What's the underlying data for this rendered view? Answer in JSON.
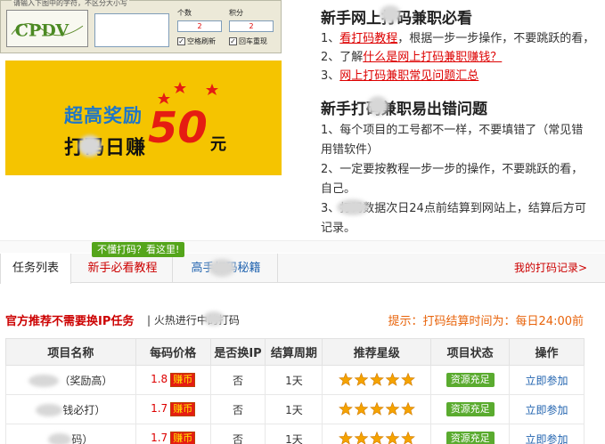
{
  "captcha": {
    "legend": "请输入下图中的字符，不区分大小写",
    "count_label": "个数",
    "count_value": "2",
    "score_label": "积分",
    "score_value": "2",
    "refresh_label": "空格刷新",
    "enter_label": "回车重现",
    "image_text": "CPDV"
  },
  "banner": {
    "line1": "超高奖励",
    "line2": "打码日赚",
    "amount": "50",
    "unit": "元"
  },
  "article": {
    "heading1": "新手网上打码兼职必看",
    "item1_prefix": "1、",
    "item1_link": "看打码教程",
    "item1_suffix": "，根据一步一步操作，不要跳跃的看，",
    "item2_prefix": "2、了解",
    "item2_link": "什么是网上打码兼职赚钱？",
    "item3_prefix": "3、",
    "item3_link": "网上打码兼职常见问题汇总",
    "heading2": "新手打码兼职易出错问题",
    "p1a": "1、每个项目的工号都不一样，不要填错了（常见错",
    "p1b": "用错软件）",
    "p2a": "2、一定要按教程一步一步的操作，不要跳跃的看，",
    "p2b": "自己。",
    "p3a": "3、打码数据次日24点前结算到网站上，结算后方可",
    "p3b": "记录。"
  },
  "hint": "不懂打码？看这里!",
  "tabs": {
    "active": "任务列表",
    "tab2": "新手必看教程",
    "tab3": "高手打码秘籍",
    "right": "我的打码记录>"
  },
  "recommend": {
    "title": "官方推荐不需要换IP任务",
    "sub": "| 火热进行中的打码",
    "tip": "提示：打码结算时间为：每日24:00前"
  },
  "table": {
    "headers": [
      "项目名称",
      "每码价格",
      "是否换IP",
      "结算周期",
      "推荐星级",
      "项目状态",
      "操作"
    ],
    "rows": [
      {
        "name": "（奖励高）",
        "price": "1.8",
        "tag": "赚币",
        "ip": "否",
        "cycle": "1天",
        "stars": 5,
        "status": "资源充足",
        "action": "立即参加"
      },
      {
        "name": "钱必打）",
        "price": "1.7",
        "tag": "赚币",
        "ip": "否",
        "cycle": "1天",
        "stars": 5,
        "status": "资源充足",
        "action": "立即参加"
      },
      {
        "name": "码）",
        "price": "1.7",
        "tag": "赚币",
        "ip": "否",
        "cycle": "1天",
        "stars": 5,
        "status": "资源充足",
        "action": "立即参加"
      }
    ]
  },
  "colors": {
    "accent_red": "#e51c12",
    "link_blue": "#2365b0",
    "banner_yellow": "#f5c400",
    "status_green": "#5aab2f",
    "tip_orange": "#e8630a"
  }
}
